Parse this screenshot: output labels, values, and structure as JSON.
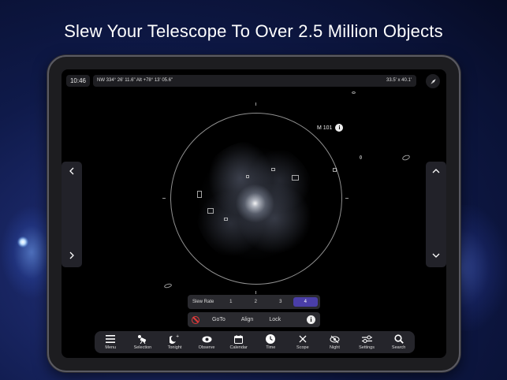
{
  "headline": "Slew Your Telescope To Over 2.5 Million Objects",
  "status": {
    "time": "10:46",
    "coordinates": "NW 334° 26' 11.6\" Alt +78° 13' 05.6\"",
    "field_of_view": "33.5' x 40.1'"
  },
  "object": {
    "label": "M 101",
    "info_glyph": "i"
  },
  "slew": {
    "label": "Slew Rate",
    "options": [
      "1",
      "2",
      "3",
      "4"
    ],
    "selected": "4"
  },
  "actions": {
    "goto": "GoTo",
    "align": "Align",
    "lock": "Lock",
    "info_glyph": "i"
  },
  "toolbar": {
    "items": [
      {
        "label": "Menu",
        "icon": "menu-icon"
      },
      {
        "label": "Selection",
        "icon": "selection-icon"
      },
      {
        "label": "Tonight",
        "icon": "moon-icon"
      },
      {
        "label": "Observe",
        "icon": "eye-icon"
      },
      {
        "label": "Calendar",
        "icon": "calendar-icon"
      },
      {
        "label": "Time",
        "icon": "clock-icon"
      },
      {
        "label": "Scope",
        "icon": "close-icon"
      },
      {
        "label": "Night",
        "icon": "night-eye-icon"
      },
      {
        "label": "Settings",
        "icon": "sliders-icon"
      },
      {
        "label": "Search",
        "icon": "search-icon"
      }
    ]
  },
  "colors": {
    "selected_accent": "#4a3ea8",
    "stop_red": "#e23a3a",
    "background_blue": "#1a2766"
  }
}
